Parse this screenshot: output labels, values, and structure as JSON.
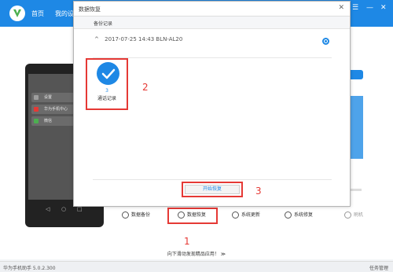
{
  "app": {
    "nav_home": "首页",
    "nav_device": "我的设",
    "window_controls": [
      "☰",
      "—",
      "✕"
    ]
  },
  "phone_preview": {
    "cards": [
      "设置",
      "华为手机中心",
      "微信"
    ]
  },
  "toolbar": {
    "items": [
      "数据备份",
      "数据恢复",
      "系统更新",
      "系统修复",
      "刷机"
    ]
  },
  "annotations": [
    "1",
    "2",
    "3"
  ],
  "footer": {
    "scroll_hint": "向下滑动发现精品应用！ ≫",
    "version": "华为手机助手 5.0.2.300",
    "task_manager": "任务管理"
  },
  "dialog": {
    "title": "数据恢复",
    "close": "✕",
    "section_label": "备份记录",
    "record": {
      "expand_icon": "^",
      "text": "2017-07-25 14:43 BLN-AL20"
    },
    "items": [
      {
        "count": "3",
        "label": "通话记录"
      }
    ],
    "start_button": "开始恢复"
  },
  "colors": {
    "brand_blue": "#1e88e5",
    "annotation_red": "#e53935"
  }
}
